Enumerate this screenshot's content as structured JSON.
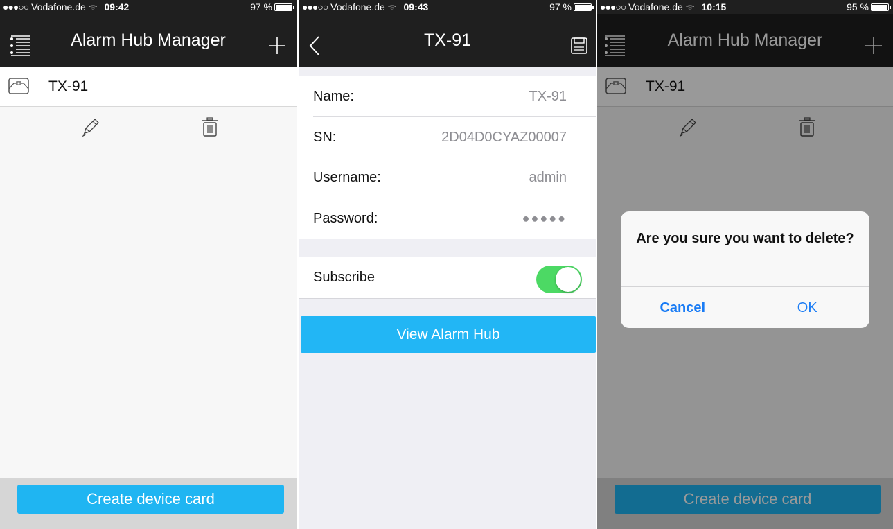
{
  "screens": [
    {
      "status": {
        "carrier": "Vodafone.de",
        "time": "09:42",
        "battery": "97 %",
        "battery_level": 0.97
      },
      "nav": {
        "title": "Alarm Hub Manager"
      },
      "device": {
        "name": "TX-91"
      },
      "bottom": {
        "create_label": "Create device card"
      }
    },
    {
      "status": {
        "carrier": "Vodafone.de",
        "time": "09:43",
        "battery": "97 %",
        "battery_level": 0.97
      },
      "nav": {
        "title": "TX-91"
      },
      "form": {
        "name_label": "Name:",
        "name_value": "TX-91",
        "sn_label": "SN:",
        "sn_value": "2D04D0CYAZ00007",
        "username_label": "Username:",
        "username_value": "admin",
        "password_label": "Password:",
        "password_value": "●●●●●",
        "subscribe_label": "Subscribe",
        "subscribe_on": true
      },
      "view_label": "View Alarm Hub"
    },
    {
      "status": {
        "carrier": "Vodafone.de",
        "time": "10:15",
        "battery": "95 %",
        "battery_level": 0.95
      },
      "nav": {
        "title": "Alarm Hub Manager"
      },
      "device": {
        "name": "TX-91"
      },
      "bottom": {
        "create_label": "Create device card"
      },
      "alert": {
        "message": "Are you sure you want to delete?",
        "cancel": "Cancel",
        "ok": "OK"
      }
    }
  ],
  "colors": {
    "accent": "#1fb5f2",
    "toggle_on": "#4cd964",
    "alert_button": "#1a7cf5",
    "navbar": "#1f1f1f"
  }
}
